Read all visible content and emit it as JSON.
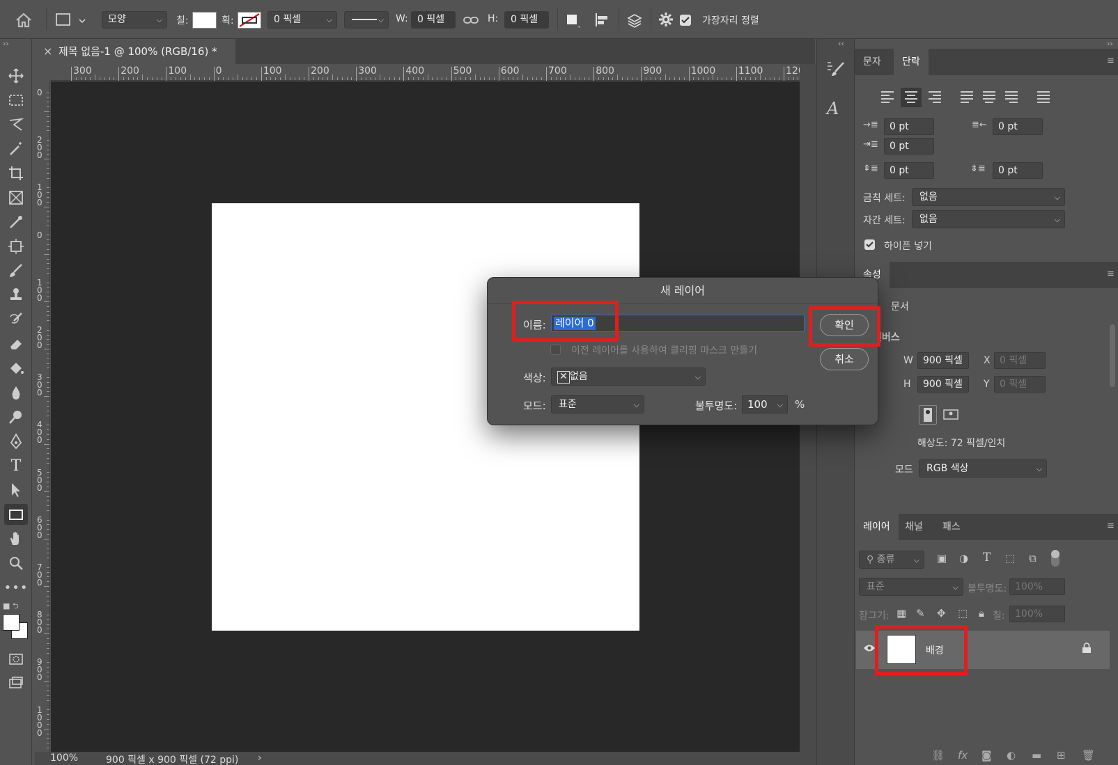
{
  "options_bar": {
    "shape_mode": "모양",
    "fill_label": "칠:",
    "stroke_label": "획:",
    "stroke_width": "0 픽셀",
    "w_label": "W:",
    "w_value": "0 픽셀",
    "h_label": "H:",
    "h_value": "0 픽셀",
    "align_edges_label": "가장자리 정렬"
  },
  "document": {
    "tab_title": "제목 없음-1 @ 100% (RGB/16) *",
    "zoom": "100%",
    "doc_info": "900 픽셀 x 900 픽셀 (72 ppi)",
    "hruler_ticks": [
      "300",
      "200",
      "100",
      "0",
      "100",
      "200",
      "300",
      "400",
      "500",
      "600",
      "700",
      "800",
      "900",
      "1000",
      "1100",
      "120"
    ],
    "vruler_ticks": [
      "0",
      "200",
      "100",
      "0",
      "100",
      "200",
      "300",
      "400",
      "500",
      "600",
      "700",
      "800",
      "900",
      "1000",
      "1"
    ]
  },
  "dialog": {
    "title": "새 레이어",
    "name_label": "이름:",
    "name_value": "레이어 0",
    "clip_label": "이전 레이어를 사용하여 클리핑 마스크 만들기",
    "color_label": "색상:",
    "color_value": "없음",
    "mode_label": "모드:",
    "mode_value": "표준",
    "opacity_label": "불투명도:",
    "opacity_value": "100",
    "opacity_unit": "%",
    "ok_label": "확인",
    "cancel_label": "취소"
  },
  "paragraph_panel": {
    "tabs": [
      "문자",
      "단락"
    ],
    "indent_left": "0 pt",
    "indent_right": "0 pt",
    "indent_first": "0 pt",
    "space_before": "0 pt",
    "space_after": "0 pt",
    "kinsoku_label": "금칙 세트:",
    "kinsoku_value": "없음",
    "mojikumi_label": "자간 세트:",
    "mojikumi_value": "없음",
    "hyphenate_label": "하이픈 넣기"
  },
  "properties_panel": {
    "tab": "속성",
    "doc_label": "문서",
    "canvas_label": "캔버스",
    "w_label": "W",
    "w_value": "900 픽셀",
    "h_label": "H",
    "h_value": "900 픽셀",
    "x_label": "X",
    "x_placeholder": "0 픽셀",
    "y_label": "Y",
    "y_placeholder": "0 픽셀",
    "resolution": "해상도: 72 픽셀/인치",
    "mode_label": "모드",
    "mode_value": "RGB 색상"
  },
  "layers_panel": {
    "tabs": [
      "레이어",
      "채널",
      "패스"
    ],
    "filter_label": "종류",
    "blend_mode": "표준",
    "opacity_label": "불투명도:",
    "opacity_value": "100%",
    "lock_label": "잠그기:",
    "fill_label": "칠:",
    "fill_value": "100%",
    "layer_name": "배경"
  },
  "colors": {
    "highlight": "#e01e1e",
    "selection": "#2a6bd6"
  }
}
